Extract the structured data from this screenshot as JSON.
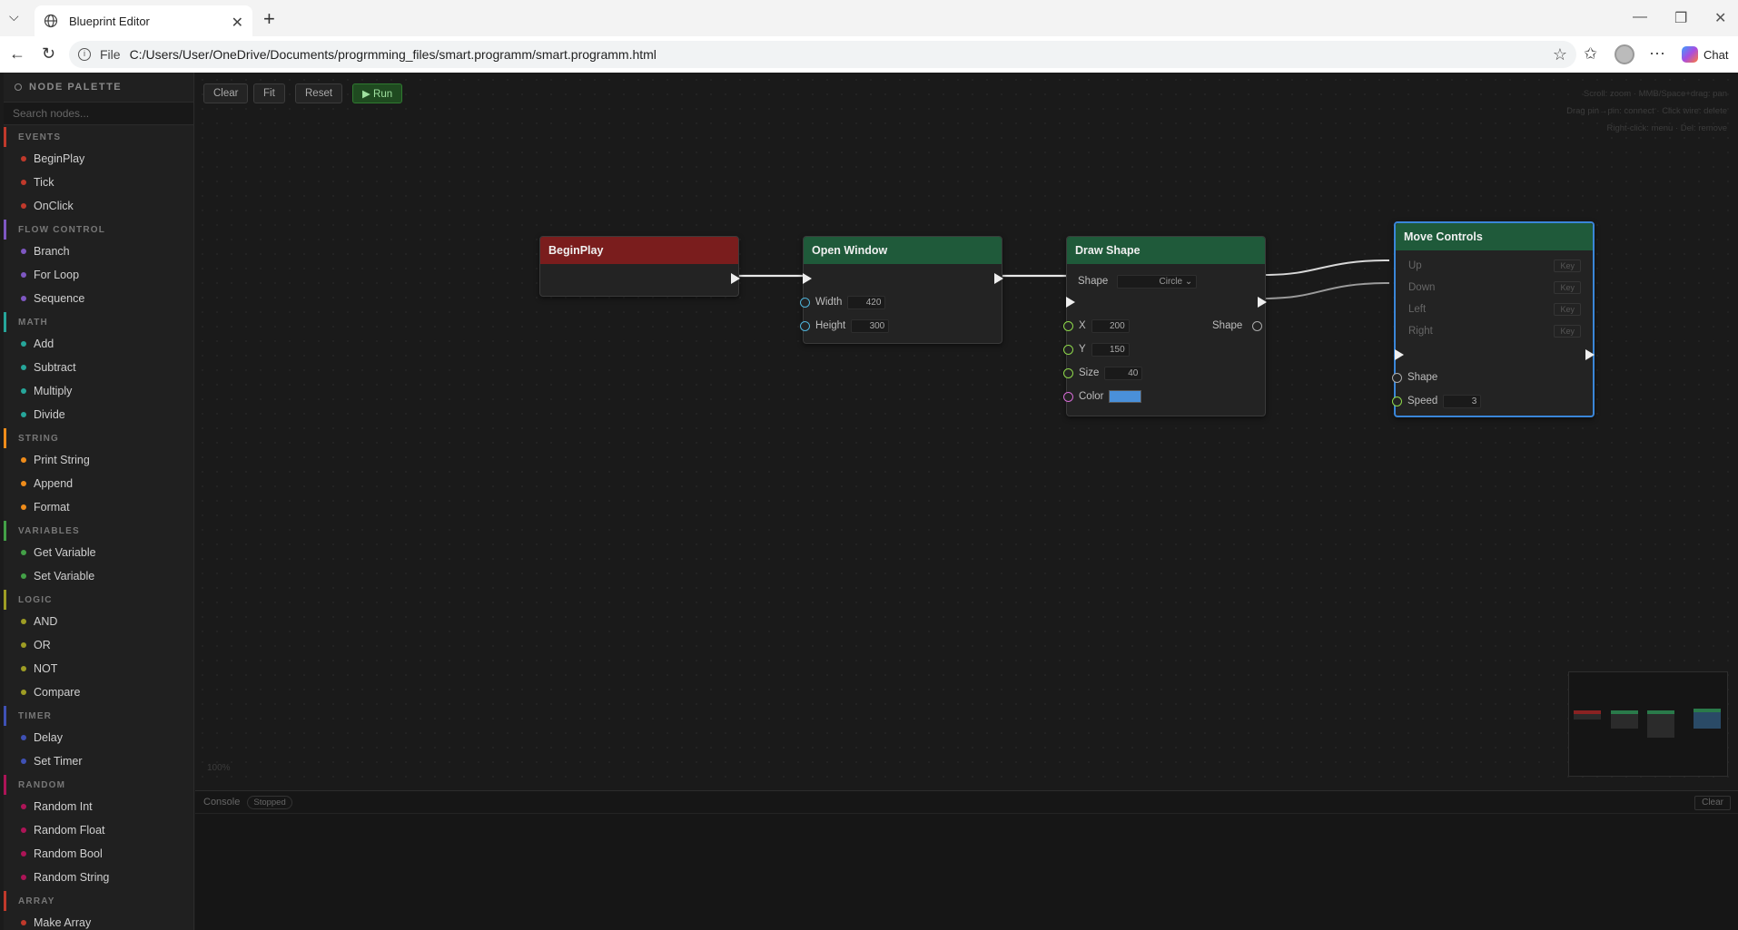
{
  "browser": {
    "tab_title": "Blueprint Editor",
    "address_prefix": "File",
    "url": "C:/Users/User/OneDrive/Documents/progrmming_files/smart.programm/smart.programm.html",
    "chat_label": "Chat"
  },
  "palette": {
    "title": "NODE PALETTE",
    "search_placeholder": "Search nodes...",
    "categories": [
      {
        "name": "EVENTS",
        "color": "#c0392b",
        "items": [
          "BeginPlay",
          "Tick",
          "OnClick"
        ]
      },
      {
        "name": "FLOW CONTROL",
        "color": "#7e57c2",
        "items": [
          "Branch",
          "For Loop",
          "Sequence"
        ]
      },
      {
        "name": "MATH",
        "color": "#26a69a",
        "items": [
          "Add",
          "Subtract",
          "Multiply",
          "Divide"
        ]
      },
      {
        "name": "STRING",
        "color": "#ef8c1a",
        "items": [
          "Print String",
          "Append",
          "Format"
        ]
      },
      {
        "name": "VARIABLES",
        "color": "#43a047",
        "items": [
          "Get Variable",
          "Set Variable"
        ]
      },
      {
        "name": "LOGIC",
        "color": "#9e9d24",
        "items": [
          "AND",
          "OR",
          "NOT",
          "Compare"
        ]
      },
      {
        "name": "TIMER",
        "color": "#3f51b5",
        "items": [
          "Delay",
          "Set Timer"
        ]
      },
      {
        "name": "RANDOM",
        "color": "#ad1457",
        "items": [
          "Random Int",
          "Random Float",
          "Random Bool",
          "Random String"
        ]
      },
      {
        "name": "ARRAY",
        "color": "#c0392b",
        "items": [
          "Make Array"
        ]
      }
    ]
  },
  "toolbar": {
    "clear": "Clear",
    "fit": "Fit",
    "reset": "Reset",
    "run": "▶ Run"
  },
  "hints": {
    "line1": "Scroll: zoom  ·  MMB/Space+drag: pan",
    "line2": "Drag pin→pin: connect  ·  Click wire: delete",
    "line3": "Right-click: menu  ·  Del: remove"
  },
  "zoom_label": "100%",
  "nodes": {
    "beginplay": {
      "title": "BeginPlay",
      "color": "#7a1d1d"
    },
    "open_window": {
      "title": "Open Window",
      "color": "#1f5a3a",
      "width_label": "Width",
      "width_value": "420",
      "height_label": "Height",
      "height_value": "300"
    },
    "draw_shape": {
      "title": "Draw Shape",
      "color": "#1f5a3a",
      "shape_label": "Shape",
      "shape_value": "Circle",
      "x_label": "X",
      "x_value": "200",
      "y_label": "Y",
      "y_value": "150",
      "size_label": "Size",
      "size_value": "40",
      "color_label": "Color",
      "color_value": "#4a90d9",
      "out_shape_label": "Shape"
    },
    "move_controls": {
      "title": "Move Controls",
      "color": "#1f5a3a",
      "up_label": "Up",
      "down_label": "Down",
      "left_label": "Left",
      "right_label": "Right",
      "key_label": "Key",
      "shape_label": "Shape",
      "speed_label": "Speed",
      "speed_value": "3"
    }
  },
  "console": {
    "label": "Console",
    "status": "Stopped",
    "clear": "Clear"
  }
}
